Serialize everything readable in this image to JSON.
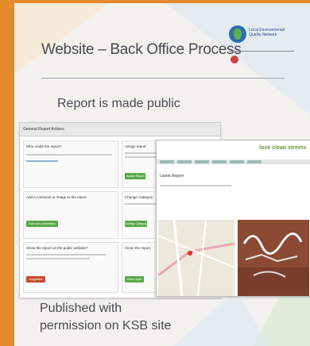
{
  "slide": {
    "title": "Website – Back Office Process",
    "subtitle": "Report is made public",
    "footer_line1": "Published with",
    "footer_line2": "permission on KSB site"
  },
  "colors": {
    "frame": "#e58a2c",
    "slide_bg": "#f3f1ee",
    "text": "#4a4a52",
    "green_button": "#5aa84a",
    "red_button": "#c94a2e",
    "brand_green": "#5b9a3a"
  },
  "logo": {
    "text": "Local Environmental Quality Network"
  },
  "back_office": {
    "header": "General Report Actions",
    "boxes": [
      {
        "title": "Who made the report?"
      },
      {
        "title": "Assign report",
        "button": "Assign Report"
      },
      {
        "title": "Add a comment or image to the report",
        "button": "Add more information"
      },
      {
        "title": "Change Category",
        "button": "Change Category"
      },
      {
        "title": "Show the report on the public website?",
        "button": "Suggested"
      },
      {
        "title": "Close the report",
        "button": "Close report"
      }
    ]
  },
  "public_site": {
    "brand": "love clean streets",
    "heading": "Latest Report"
  }
}
